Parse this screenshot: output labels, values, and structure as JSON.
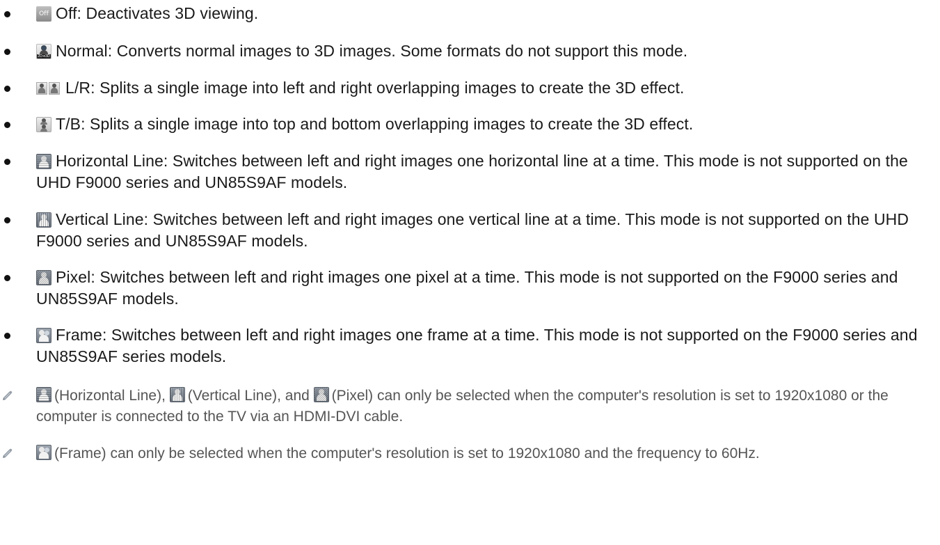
{
  "items": [
    {
      "icon": "off-mode-icon",
      "icon_label": "Off",
      "text": "Off: Deactivates 3D viewing."
    },
    {
      "icon": "normal-2d-to-3d-icon",
      "icon_label": "2D➔3D",
      "text": "Normal: Converts normal images to 3D images. Some formats do not support this mode."
    },
    {
      "icon": "left-right-icon",
      "text": "L/R: Splits a single image into left and right overlapping images to create the 3D effect."
    },
    {
      "icon": "top-bottom-icon",
      "text": "T/B: Splits a single image into top and bottom overlapping images to create the 3D effect."
    },
    {
      "icon": "horizontal-line-icon",
      "text": "Horizontal Line: Switches between left and right images one horizontal line at a time. This mode is not supported on the UHD F9000 series and UN85S9AF models."
    },
    {
      "icon": "vertical-line-icon",
      "text": "Vertical Line: Switches between left and right images one vertical line at a time. This mode is not supported on the UHD F9000 series and UN85S9AF models."
    },
    {
      "icon": "pixel-icon",
      "text": "Pixel: Switches between left and right images one pixel at a time. This mode is not supported on the F9000 series and UN85S9AF models."
    },
    {
      "icon": "frame-icon",
      "text": "Frame: Switches between left and right images one frame at a time. This mode is not supported on the F9000 series and UN85S9AF series models."
    }
  ],
  "notes": [
    {
      "part1": "(Horizontal Line), ",
      "part2": "(Vertical Line), and ",
      "part3": "(Pixel) can only be selected when the computer's resolution is set to 1920x1080 or the computer is connected to the TV via an HDMI-DVI cable."
    },
    {
      "part1": "(Frame) can only be selected when the computer's resolution is set to 1920x1080 and the frequency to 60Hz."
    }
  ],
  "colors": {
    "text": "#1a1a1a",
    "note_text": "#555555",
    "pencil": "#9aa3ad"
  }
}
